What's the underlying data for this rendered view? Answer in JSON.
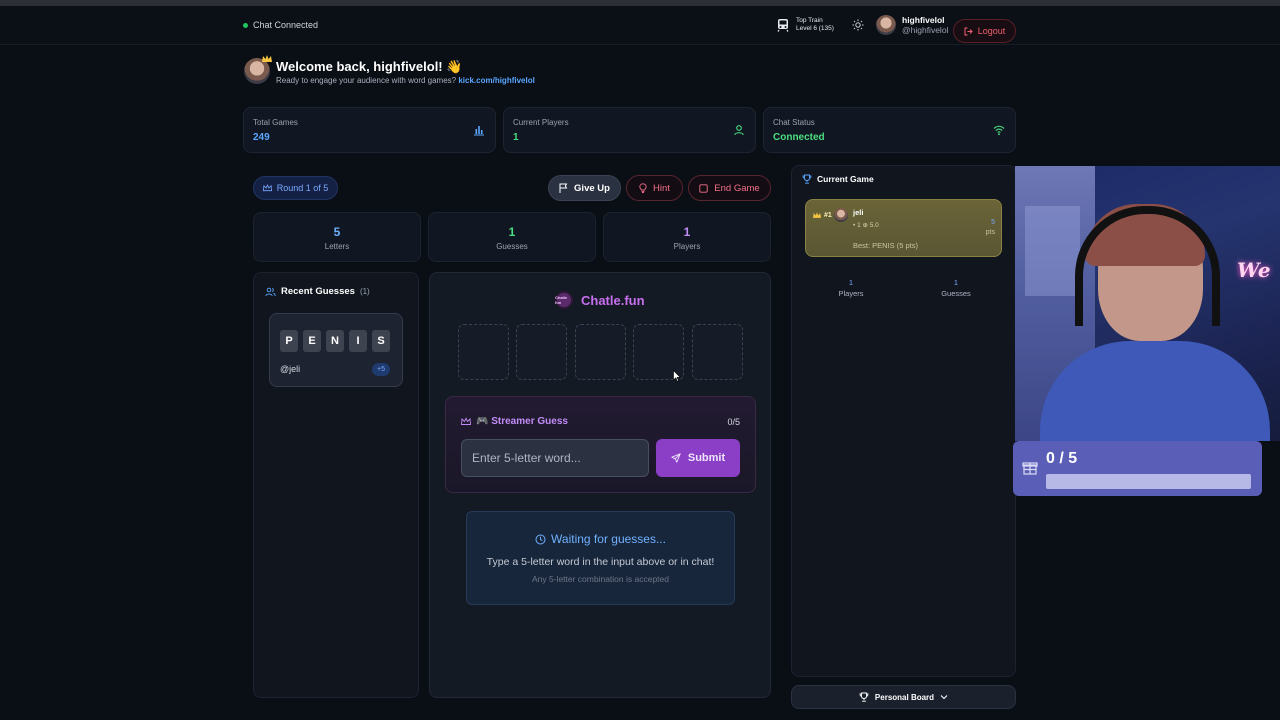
{
  "navbar": {
    "chat_status": "Chat Connected",
    "train_line1": "Top Train",
    "train_line2": "Level 6 (135)",
    "username": "highfivelol",
    "handle": "@highfivelol",
    "logout_label": "Logout"
  },
  "welcome": {
    "title": "Welcome back, highfivelol! 👋",
    "subtitle": "Ready to engage your audience with word games?",
    "channel_link": "kick.com/highfivelol"
  },
  "stats": [
    {
      "label": "Total Games",
      "value": "249",
      "color": "#5aa7ff",
      "icon": "bar-chart-icon"
    },
    {
      "label": "Current Players",
      "value": "1",
      "color": "#4ade80",
      "icon": "user-icon"
    },
    {
      "label": "Chat Status",
      "value": "Connected",
      "color": "#4ade80",
      "icon": "wifi-icon"
    }
  ],
  "game_controls": {
    "round_label": "Round 1 of 5",
    "give_up_label": "Give Up",
    "hint_label": "Hint",
    "end_game_label": "End Game"
  },
  "metrics": [
    {
      "value": "5",
      "label": "Letters",
      "color": "#6fb1ff"
    },
    {
      "value": "1",
      "label": "Guesses",
      "color": "#4ade80"
    },
    {
      "value": "1",
      "label": "Players",
      "color": "#c28cf7"
    }
  ],
  "recent_guesses": {
    "title": "Recent Guesses",
    "count": "(1)",
    "items": [
      {
        "letters": [
          "P",
          "E",
          "N",
          "I",
          "S"
        ],
        "user": "@jeli",
        "points": "+5"
      }
    ]
  },
  "board": {
    "brand": "Chatle.fun",
    "brand_logo_text": "Chatle fun",
    "slots": 5
  },
  "streamer_guess": {
    "title": "🎮 Streamer Guess",
    "count": "0/5",
    "input_placeholder": "Enter 5-letter word...",
    "submit_label": "Submit"
  },
  "waiting": {
    "title": "Waiting for guesses...",
    "subtitle": "Type a 5-letter word in the input above or in chat!",
    "note": "Any 5-letter combination is accepted"
  },
  "current_game": {
    "title": "Current Game",
    "leader": {
      "rank": "#1",
      "name": "jeli",
      "stats": "• 1 ⊕ 5.0",
      "points": "5",
      "points_unit": "pts",
      "best": "Best: PENIS (5 pts)"
    },
    "footer": [
      {
        "value": "1",
        "label": "Players"
      },
      {
        "value": "1",
        "label": "Guesses"
      }
    ]
  },
  "personal_board_label": "Personal Board",
  "overlay": {
    "neon_text": "We",
    "goal_text": "0 / 5",
    "goal_progress": 0
  },
  "colors": {
    "accent_blue": "#5aa7ff",
    "accent_green": "#4ade80",
    "accent_purple": "#c28cf7",
    "danger": "#f36f8a"
  }
}
